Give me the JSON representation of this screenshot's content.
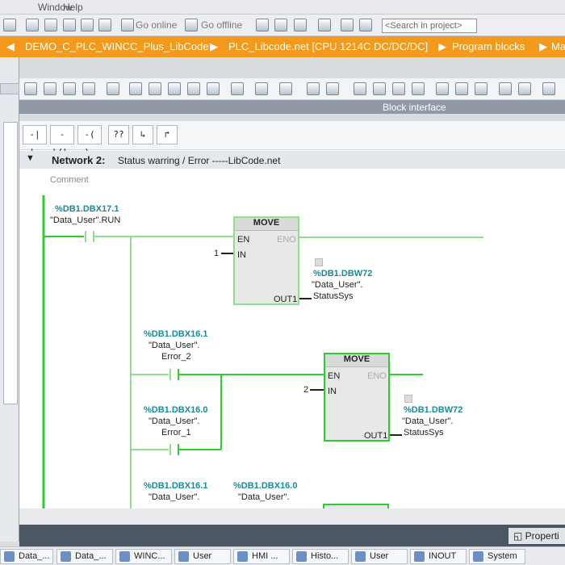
{
  "menu": {
    "items": [
      "Window",
      "Help"
    ]
  },
  "toolbar": {
    "go_online": "Go online",
    "go_offline": "Go offline"
  },
  "search": {
    "placeholder": "<Search in project>"
  },
  "breadcrumb": {
    "items": [
      "DEMO_C_PLC_WINCC_Plus_LibCode",
      "PLC_Libcode.net [CPU 1214C DC/DC/DC]",
      "Program blocks",
      "Ma"
    ]
  },
  "block_interface": "Block interface",
  "network": {
    "title": "Network 2:",
    "description": "Status warring / Error -----LibCode.net",
    "comment": "Comment"
  },
  "ladder": {
    "contact_run": {
      "address": "%DB1.DBX17.1",
      "tag": "\"Data_User\".RUN"
    },
    "move1": {
      "title": "MOVE",
      "en": "EN",
      "eno": "ENO",
      "in": "IN",
      "in_value": "1",
      "out": "OUT1",
      "badge": "1",
      "out_address": "%DB1.DBW72",
      "out_tag1": "\"Data_User\".",
      "out_tag2": "StatusSys"
    },
    "contact_error2": {
      "address": "%DB1.DBX16.1",
      "tag1": "\"Data_User\".",
      "tag2": "Error_2"
    },
    "contact_error1": {
      "address": "%DB1.DBX16.0",
      "tag1": "\"Data_User\".",
      "tag2": "Error_1"
    },
    "move2": {
      "title": "MOVE",
      "en": "EN",
      "eno": "ENO",
      "in": "IN",
      "in_value": "2",
      "out": "OUT1",
      "badge": "2",
      "out_address": "%DB1.DBW72",
      "out_tag1": "\"Data_User\".",
      "out_tag2": "StatusSys"
    },
    "contact3": {
      "address": "%DB1.DBX16.1",
      "tag1": "\"Data_User\"."
    },
    "contact4": {
      "address": "%DB1.DBX16.0",
      "tag1": "\"Data_User\"."
    }
  },
  "properties": "Properti",
  "taskbar": [
    "Data_...",
    "Data_...",
    "WINC...",
    "User",
    "HMI ...",
    "Histo...",
    "User",
    "INOUT",
    "System"
  ],
  "colors": {
    "accent": "#f39a1d",
    "rung_active": "#2ecc2e",
    "rung_inactive": "#8ee08e",
    "address": "#1a8a96"
  }
}
